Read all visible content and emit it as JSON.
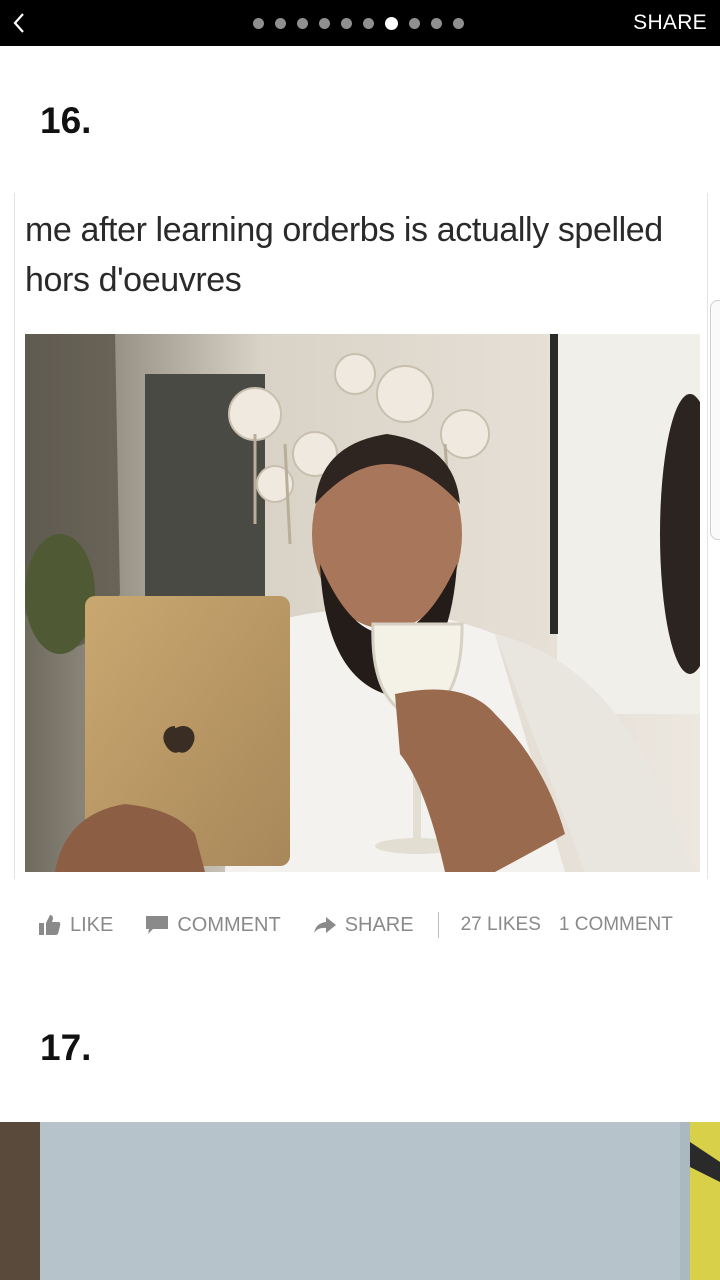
{
  "topbar": {
    "share_label": "SHARE",
    "dot_count": 10,
    "active_dot": 6
  },
  "items": [
    {
      "number": "16.",
      "caption": "me after learning orderbs is actually spelled hors d'oeuvres",
      "actions": {
        "like_label": "LIKE",
        "comment_label": "COMMENT",
        "share_label": "SHARE"
      },
      "stats": {
        "likes": "27 LIKES",
        "comments": "1 COMMENT"
      }
    },
    {
      "number": "17."
    }
  ],
  "colors": {
    "topbar_bg": "#000000",
    "action_text": "#8a8a8a"
  }
}
